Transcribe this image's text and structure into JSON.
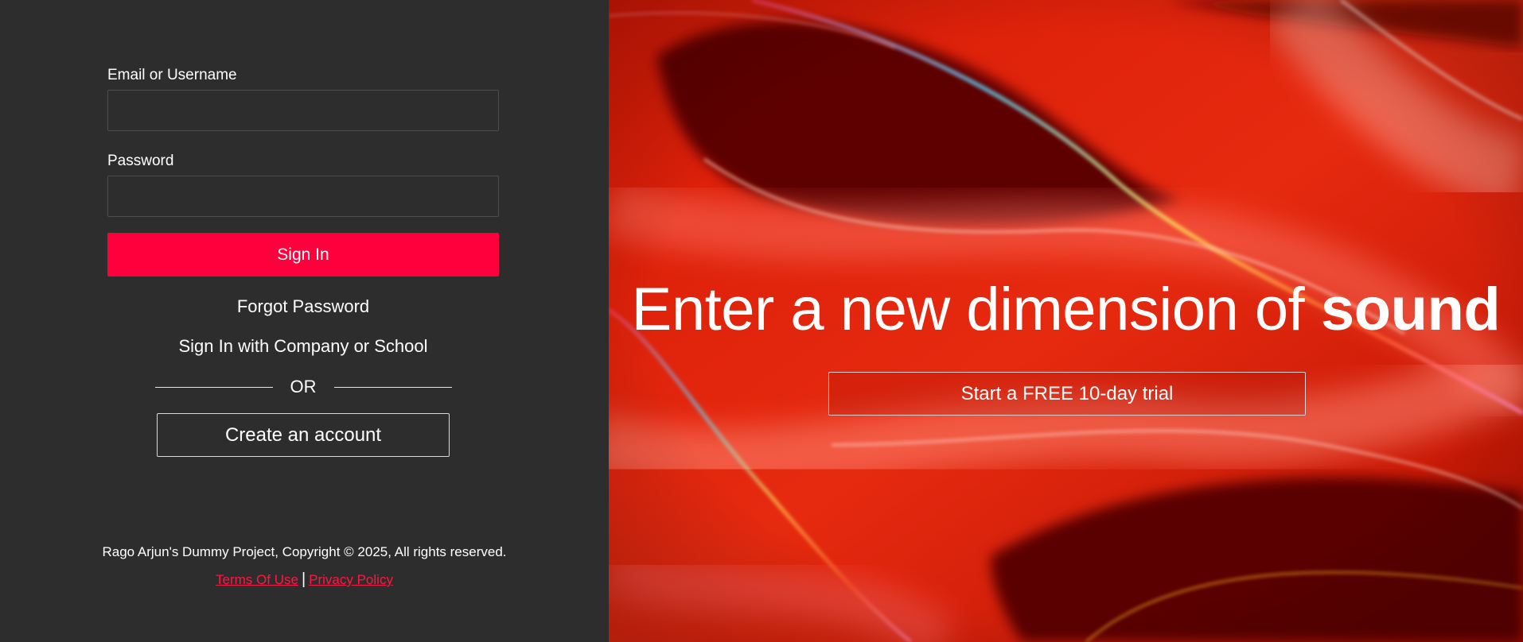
{
  "login": {
    "email_label": "Email or Username",
    "email_value": "",
    "password_label": "Password",
    "password_value": "",
    "signin_label": "Sign In",
    "forgot_label": "Forgot Password",
    "company_label": "Sign In with Company or School",
    "or_label": "OR",
    "create_label": "Create an account"
  },
  "footer": {
    "copyright": "Rago Arjun's Dummy Project, Copyright © 2025, All rights reserved.",
    "terms_label": "Terms Of Use",
    "separator": "|",
    "privacy_label": "Privacy Policy"
  },
  "hero": {
    "title_prefix": "Enter a new dimension of ",
    "title_emphasis": "sound",
    "trial_label": "Start a FREE 10-day trial",
    "background": "red-flowing-waves-image"
  },
  "colors": {
    "panel_bg": "#2d2d2d",
    "accent": "#ff003c",
    "link": "#ff1744",
    "hero_red": "#c41200",
    "hero_dark": "#5e0500"
  }
}
